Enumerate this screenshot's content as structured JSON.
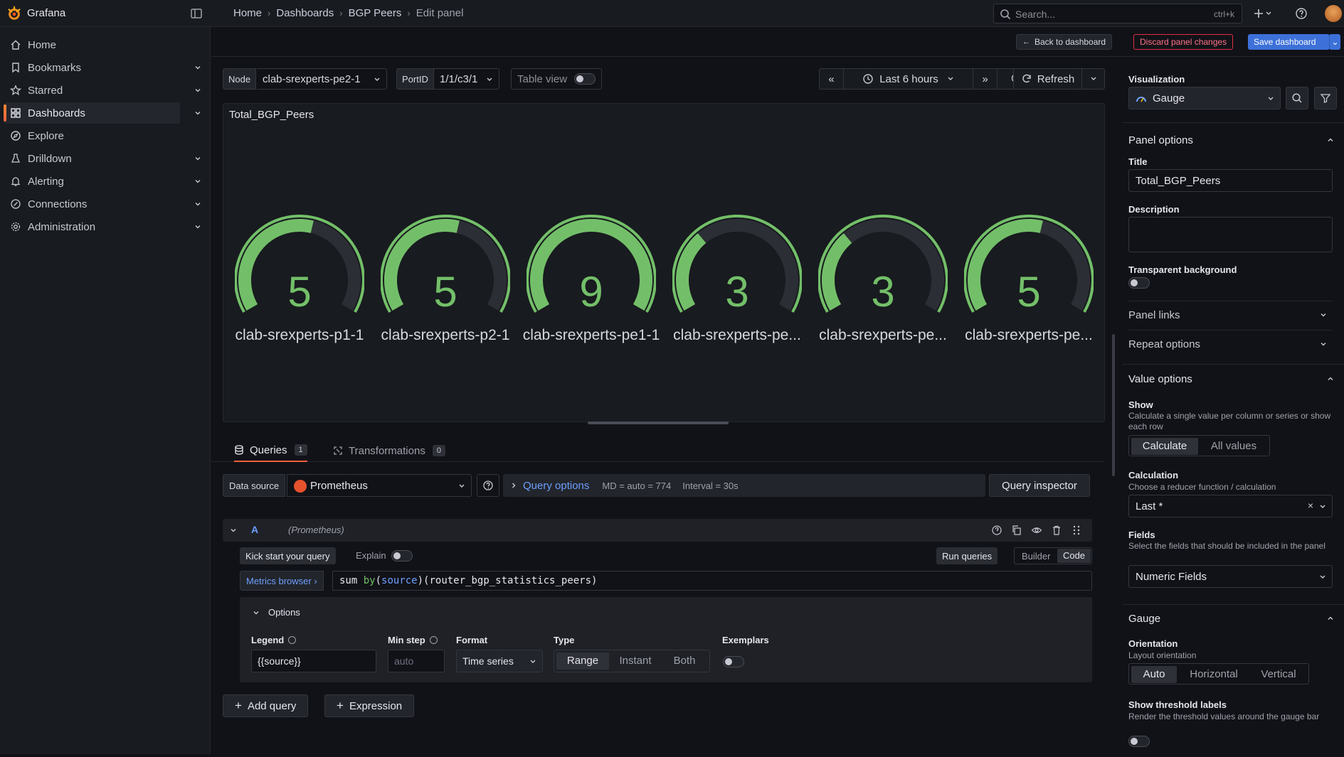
{
  "app": {
    "name": "Grafana",
    "brand_color": "#f55f3e"
  },
  "breadcrumb": [
    "Home",
    "Dashboards",
    "BGP Peers",
    "Edit panel"
  ],
  "search": {
    "placeholder": "Search...",
    "shortcut": "ctrl+k"
  },
  "sidebar": {
    "items": [
      {
        "label": "Home",
        "icon": "home-icon",
        "expandable": false,
        "active": false
      },
      {
        "label": "Bookmarks",
        "icon": "bookmark-icon",
        "expandable": true,
        "active": false
      },
      {
        "label": "Starred",
        "icon": "star-icon",
        "expandable": true,
        "active": false
      },
      {
        "label": "Dashboards",
        "icon": "apps-icon",
        "expandable": true,
        "active": true
      },
      {
        "label": "Explore",
        "icon": "compass-icon",
        "expandable": false,
        "active": false
      },
      {
        "label": "Drilldown",
        "icon": "drilldown-icon",
        "expandable": true,
        "active": false
      },
      {
        "label": "Alerting",
        "icon": "bell-icon",
        "expandable": true,
        "active": false
      },
      {
        "label": "Connections",
        "icon": "link-icon",
        "expandable": true,
        "active": false
      },
      {
        "label": "Administration",
        "icon": "cog-icon",
        "expandable": true,
        "active": false
      }
    ]
  },
  "actions": {
    "back": "Back to dashboard",
    "discard": "Discard panel changes",
    "save": "Save dashboard"
  },
  "variables": {
    "node_label": "Node",
    "node_value": "clab-srexperts-pe2-1",
    "port_label": "PortID",
    "port_value": "1/1/c3/1",
    "table_view": "Table view"
  },
  "time": {
    "range": "Last 6 hours",
    "refresh": "Refresh"
  },
  "panel": {
    "title": "Total_BGP_Peers",
    "gauge_color": "#73bf69",
    "gauge_max": 9,
    "gauges": [
      {
        "value": 5,
        "name": "clab-srexperts-p1-1"
      },
      {
        "value": 5,
        "name": "clab-srexperts-p2-1"
      },
      {
        "value": 9,
        "name": "clab-srexperts-pe1-1"
      },
      {
        "value": 3,
        "name": "clab-srexperts-pe..."
      },
      {
        "value": 3,
        "name": "clab-srexperts-pe..."
      },
      {
        "value": 5,
        "name": "clab-srexperts-pe..."
      }
    ]
  },
  "query_tabs": [
    {
      "label": "Queries",
      "count": "1"
    },
    {
      "label": "Transformations",
      "count": "0"
    }
  ],
  "datasource": {
    "label": "Data source",
    "value": "Prometheus",
    "query_options": "Query options",
    "md": "MD = auto = 774",
    "interval": "Interval = 30s",
    "inspector": "Query inspector"
  },
  "query": {
    "ref": "A",
    "ds": "(Prometheus)",
    "kick_start": "Kick start your query",
    "explain": "Explain",
    "run": "Run queries",
    "mode_builder": "Builder",
    "mode_code": "Code",
    "metrics_browser": "Metrics browser ›",
    "expr": "sum by(source)(router_bgp_statistics_peers)",
    "options": {
      "title": "Options",
      "legend_label": "Legend",
      "legend_value": "{{source}}",
      "minstep_label": "Min step",
      "minstep_placeholder": "auto",
      "format_label": "Format",
      "format_value": "Time series",
      "type_label": "Type",
      "type_range": "Range",
      "type_instant": "Instant",
      "type_both": "Both",
      "exemplars_label": "Exemplars"
    }
  },
  "add": {
    "query": "Add query",
    "expression": "Expression"
  },
  "pane": {
    "vis_label": "Visualization",
    "vis_value": "Gauge",
    "panel_options": "Panel options",
    "title_label": "Title",
    "title_value": "Total_BGP_Peers",
    "desc_label": "Description",
    "transparent_label": "Transparent background",
    "panel_links": "Panel links",
    "repeat_options": "Repeat options",
    "value_options": "Value options",
    "show_label": "Show",
    "show_desc": "Calculate a single value per column or series or show each row",
    "show_calculate": "Calculate",
    "show_all": "All values",
    "calc_label": "Calculation",
    "calc_desc": "Choose a reducer function / calculation",
    "calc_value": "Last *",
    "fields_label": "Fields",
    "fields_desc": "Select the fields that should be included in the panel",
    "fields_value": "Numeric Fields",
    "gauge_section": "Gauge",
    "orient_label": "Orientation",
    "orient_desc": "Layout orientation",
    "orient_auto": "Auto",
    "orient_h": "Horizontal",
    "orient_v": "Vertical",
    "thresh_label": "Show threshold labels",
    "thresh_desc": "Render the threshold values around the gauge bar"
  }
}
